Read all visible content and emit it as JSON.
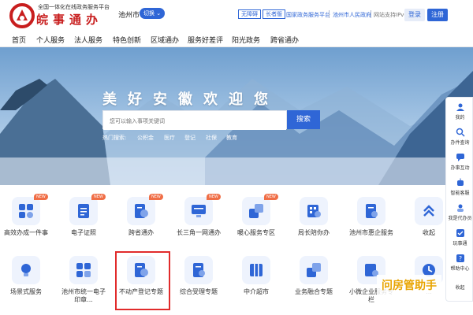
{
  "header": {
    "platform_slogan": "全国一体化在线政务服务平台",
    "brand": "皖事通办",
    "city": "池州市",
    "switch_label": "切换",
    "barrier_free": "无障碍",
    "elder_version": "长者版",
    "link_national": "国家政务服务平台",
    "link_gov": "池州市人民政府",
    "ipv6_text": "网站支持IPv6",
    "login": "登录",
    "register": "注册"
  },
  "nav": [
    "首页",
    "个人服务",
    "法人服务",
    "特色创新",
    "区域通办",
    "服务好差评",
    "阳光政务",
    "跨省通办"
  ],
  "banner": {
    "welcome": "美好安徽欢迎您",
    "search_placeholder": "您可以输入事项关键词",
    "search_button": "搜索",
    "hot_label": "热门搜索:",
    "hot_items": [
      "公积金",
      "医疗",
      "登记",
      "社保",
      "教育"
    ]
  },
  "services_row1": [
    {
      "label": "高效办成一件事",
      "new": "NEW"
    },
    {
      "label": "电子证照",
      "new": "NEW"
    },
    {
      "label": "跨省通办",
      "new": "NEW"
    },
    {
      "label": "长三角一网通办",
      "new": "NEW"
    },
    {
      "label": "暖心服务专区",
      "new": "NEW"
    },
    {
      "label": "局长陪你办",
      "new": ""
    },
    {
      "label": "池州市惠企服务",
      "new": ""
    },
    {
      "label": "收起",
      "new": ""
    }
  ],
  "services_row2": [
    {
      "label": "场景式服务"
    },
    {
      "label": "池州市统一电子印章..."
    },
    {
      "label": "不动产登记专题"
    },
    {
      "label": "综合受理专题"
    },
    {
      "label": "中介超市"
    },
    {
      "label": "业务融合专题"
    },
    {
      "label": "小微企业服务专栏"
    },
    {
      "label": "..."
    }
  ],
  "sidebar": [
    "我的",
    "办件查询",
    "办事互动",
    "智能客服",
    "我是代办员",
    "玩事通",
    "帮助中心",
    "收起"
  ],
  "watermark": "问房管助手",
  "colors": {
    "brand_red": "#c81e1e",
    "accent_blue": "#2f66d6",
    "new_badge": "#f06e46"
  }
}
